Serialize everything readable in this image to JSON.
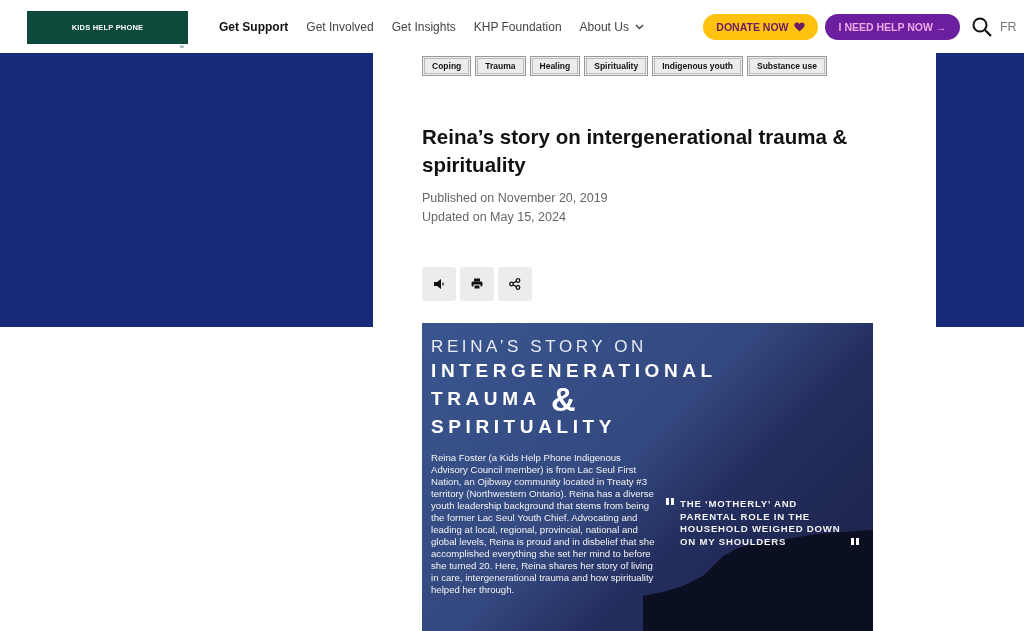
{
  "header": {
    "logo": {
      "tagline": "KIDS HELP PHONE",
      "trademark": "™"
    },
    "nav": [
      {
        "label": "Get Support",
        "selected": true
      },
      {
        "label": "Get Involved",
        "selected": false
      },
      {
        "label": "Get Insights",
        "selected": false
      },
      {
        "label": "KHP Foundation",
        "selected": false
      },
      {
        "label": "About Us",
        "selected": false,
        "dropdown": true
      }
    ],
    "donate_button": "DONATE NOW",
    "help_button": "I NEED HELP NOW →",
    "language": "FR"
  },
  "article": {
    "tags": [
      "Coping",
      "Trauma",
      "Healing",
      "Spirituality",
      "Indigenous youth",
      "Substance use"
    ],
    "title": "Reina’s story on intergenerational trauma & spirituality",
    "published": "Published on November 20, 2019",
    "updated": "Updated on May 15, 2024",
    "actions": [
      {
        "kind": "listen"
      },
      {
        "kind": "print"
      },
      {
        "kind": "share"
      }
    ],
    "graphic": {
      "kicker": "REINA’S STORY ON",
      "title_lines": [
        "INTERGENERATIONAL",
        "TRAUMA"
      ],
      "ampersand": "&",
      "title_last": "SPIRITUALITY",
      "body": "Reina Foster (a Kids Help Phone Indigenous Advisory Council member) is from Lac Seul First Nation, an Ojibway community located in Treaty #3 territory (Northwestern Ontario). Reina has a diverse youth leadership background that stems from being the former Lac Seul Youth Chief. Advocating and leading at local, regional, provincial, national and global levels, Reina is proud and in disbelief that she accomplished everything she set her mind to before she turned 20. Here, Reina shares her story of living in care, intergenerational trauma and how spirituality helped her through.",
      "quote": "THE ‘MOTHERLY’ AND PARENTAL ROLE IN THE HOUSEHOLD WEIGHED DOWN ON MY SHOULDERS"
    }
  }
}
